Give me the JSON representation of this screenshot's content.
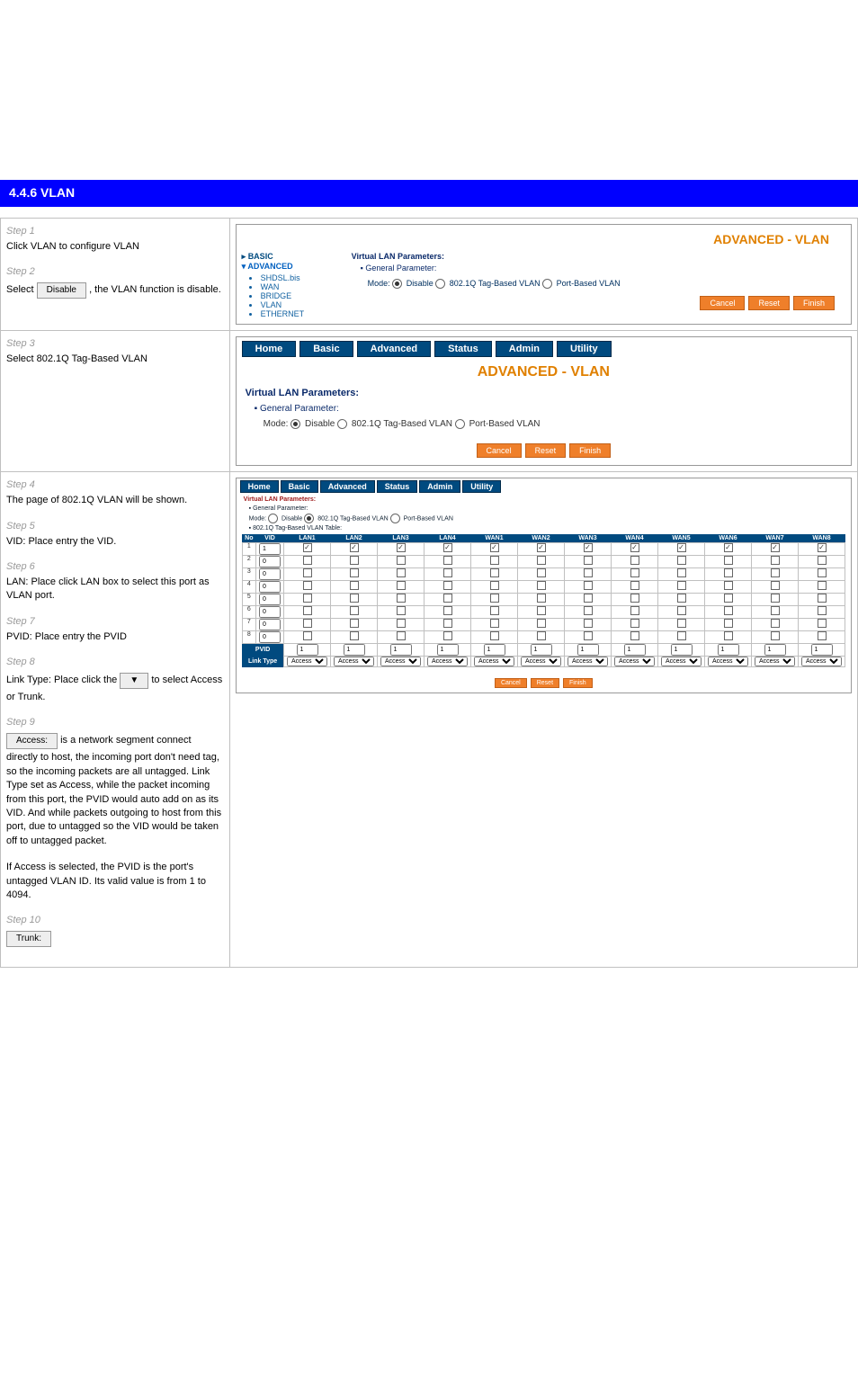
{
  "banner": "4.4.6  VLAN",
  "steps": {
    "s1": {
      "label": "Step 1",
      "body": "Click VLAN to configure VLAN"
    },
    "s2": {
      "label": "Step 2",
      "body1": "Select ",
      "body2": ", the VLAN function is disable.",
      "btn": "Disable"
    },
    "s3": {
      "label": "Step 3",
      "body": "Select  802.1Q Tag-Based VLAN"
    },
    "s4": {
      "label": "Step 4",
      "body": "The page of 802.1Q VLAN will be shown."
    },
    "s5": {
      "label": "Step 5",
      "body": "VID: Place entry the VID."
    },
    "s6": {
      "label": "Step 6",
      "body": "LAN: Place click LAN box to select this port as VLAN port."
    },
    "s7": {
      "label": "Step 7",
      "body": "PVID: Place entry the PVID"
    },
    "s8": {
      "label": "Step 8",
      "body1": "Link Type: Place click the ",
      "body2": " to select Access or Trunk.",
      "btn": "▼"
    },
    "s9": {
      "label": "Step 9",
      "body": "is a network segment connect directly to host, the incoming port don't need tag, so the incoming packets are all untagged. Link Type set as Access, while the packet incoming from this port, the PVID would auto add on as its VID. And while packets outgoing to host from this port, due to  untagged so the VID would be taken off to untagged packet.",
      "btn": "Access:"
    },
    "s9c": "If Access is selected, the PVID is the port's untagged VLAN ID. Its valid value is from 1 to 4094.",
    "s10": {
      "label": "Step 10",
      "body": "",
      "btn": "Trunk:"
    }
  },
  "screenshot1": {
    "title": "ADVANCED - VLAN",
    "nav_basic": "BASIC",
    "nav_advanced": "ADVANCED",
    "nav_items": [
      "SHDSL.bis",
      "WAN",
      "BRIDGE",
      "VLAN",
      "ETHERNET"
    ],
    "hdr": "Virtual LAN Parameters:",
    "sub": "General Parameter:",
    "mode_label": "Mode:",
    "mode_opts": [
      "Disable",
      "802.1Q Tag-Based VLAN",
      "Port-Based VLAN"
    ],
    "mode_selected": 0,
    "btns": [
      "Cancel",
      "Reset",
      "Finish"
    ]
  },
  "screenshot2": {
    "tabs": [
      "Home",
      "Basic",
      "Advanced",
      "Status",
      "Admin",
      "Utility"
    ],
    "title": "ADVANCED - VLAN",
    "hdr": "Virtual LAN Parameters:",
    "sub": "General Parameter:",
    "mode_label": "Mode:",
    "mode_opts": [
      "Disable",
      "802.1Q Tag-Based VLAN",
      "Port-Based VLAN"
    ],
    "mode_selected": 0,
    "btns": [
      "Cancel",
      "Reset",
      "Finish"
    ]
  },
  "screenshot3": {
    "tabs": [
      "Home",
      "Basic",
      "Advanced",
      "Status",
      "Admin",
      "Utility"
    ],
    "hdr": "Virtual LAN Parameters:",
    "sub": "General Parameter:",
    "mode_label": "Mode:",
    "mode_opts": [
      "Disable",
      "802.1Q Tag-Based VLAN",
      "Port-Based VLAN"
    ],
    "mode_selected": 1,
    "table_hdr": "802.1Q Tag-Based VLAN Table:",
    "cols": [
      "No",
      "VID",
      "LAN1",
      "LAN2",
      "LAN3",
      "LAN4",
      "WAN1",
      "WAN2",
      "WAN3",
      "WAN4",
      "WAN5",
      "WAN6",
      "WAN7",
      "WAN8"
    ],
    "rows": [
      {
        "no": "1",
        "vid": "1",
        "c": [
          1,
          1,
          1,
          1,
          1,
          1,
          1,
          1,
          1,
          1,
          1,
          1
        ]
      },
      {
        "no": "2",
        "vid": "0",
        "c": [
          0,
          0,
          0,
          0,
          0,
          0,
          0,
          0,
          0,
          0,
          0,
          0
        ]
      },
      {
        "no": "3",
        "vid": "0",
        "c": [
          0,
          0,
          0,
          0,
          0,
          0,
          0,
          0,
          0,
          0,
          0,
          0
        ]
      },
      {
        "no": "4",
        "vid": "0",
        "c": [
          0,
          0,
          0,
          0,
          0,
          0,
          0,
          0,
          0,
          0,
          0,
          0
        ]
      },
      {
        "no": "5",
        "vid": "0",
        "c": [
          0,
          0,
          0,
          0,
          0,
          0,
          0,
          0,
          0,
          0,
          0,
          0
        ]
      },
      {
        "no": "6",
        "vid": "0",
        "c": [
          0,
          0,
          0,
          0,
          0,
          0,
          0,
          0,
          0,
          0,
          0,
          0
        ]
      },
      {
        "no": "7",
        "vid": "0",
        "c": [
          0,
          0,
          0,
          0,
          0,
          0,
          0,
          0,
          0,
          0,
          0,
          0
        ]
      },
      {
        "no": "8",
        "vid": "0",
        "c": [
          0,
          0,
          0,
          0,
          0,
          0,
          0,
          0,
          0,
          0,
          0,
          0
        ]
      }
    ],
    "pvid_label": "PVID",
    "pvid": [
      "1",
      "1",
      "1",
      "1",
      "1",
      "1",
      "1",
      "1",
      "1",
      "1",
      "1",
      "1"
    ],
    "linktype_label": "Link Type",
    "linktype_val": "Access",
    "btns": [
      "Cancel",
      "Reset",
      "Finish"
    ]
  }
}
